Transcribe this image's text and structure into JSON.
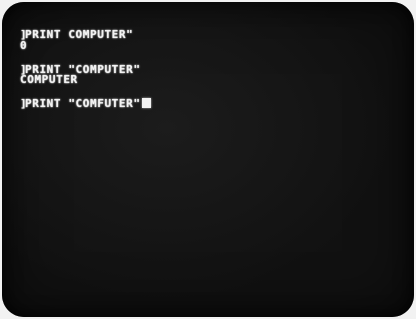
{
  "terminal": {
    "prompt_char": "]",
    "lines": [
      {
        "prompt": "]",
        "text": "PRINT COMPUTER\""
      },
      {
        "prompt": "",
        "text": "0"
      },
      {
        "prompt": "]",
        "text": "PRINT \"COMPUTER\""
      },
      {
        "prompt": "",
        "text": "COMPUTER"
      },
      {
        "prompt": "]",
        "text": "PRINT \"COMFUTER\""
      }
    ]
  },
  "colors": {
    "screen_bg": "#111111",
    "text": "#f2f2f2"
  }
}
